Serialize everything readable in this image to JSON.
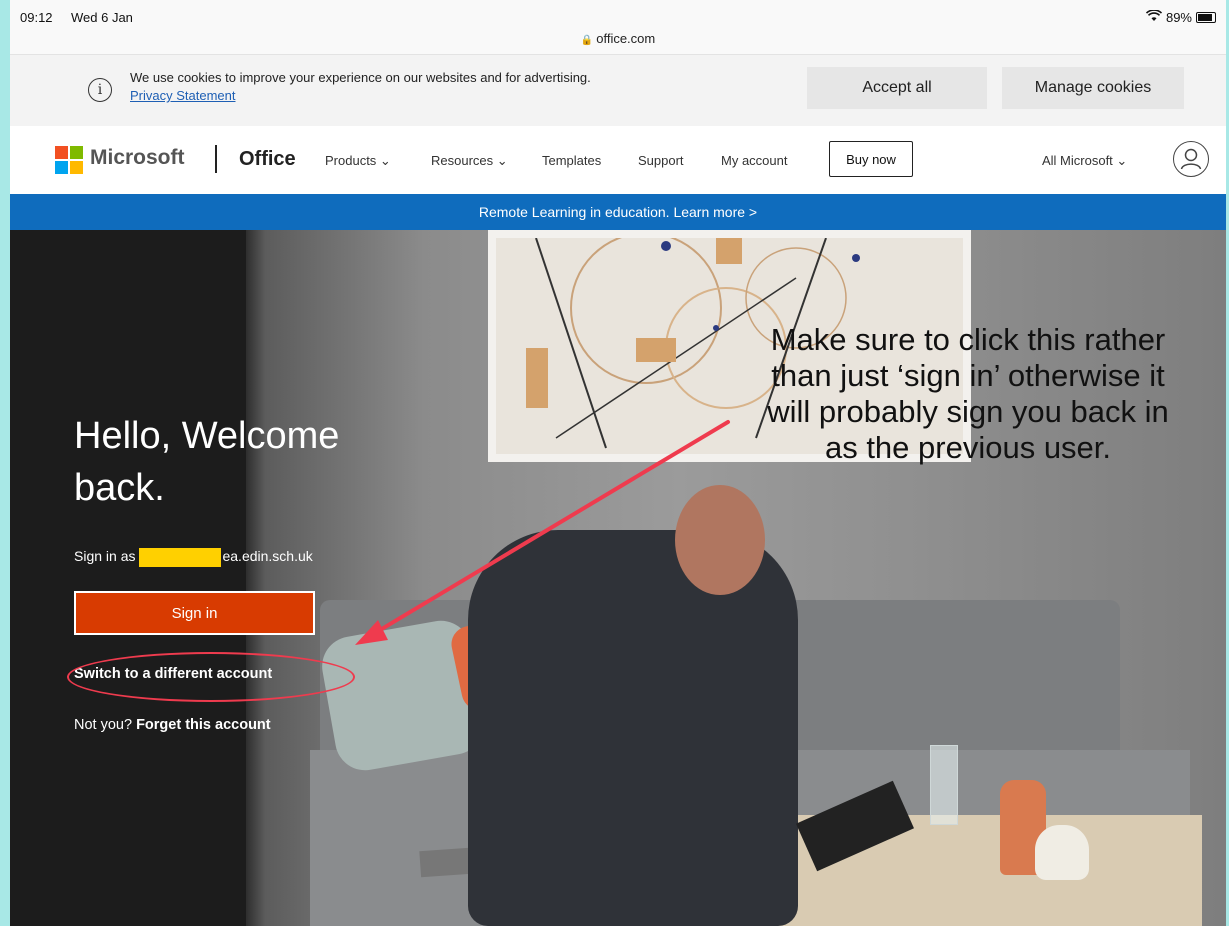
{
  "status_bar": {
    "time": "09:12",
    "date": "Wed 6 Jan",
    "url": "office.com",
    "battery": "89%"
  },
  "cookie": {
    "text": "We use cookies to improve your experience on our websites and for advertising.",
    "privacy_link": "Privacy Statement",
    "accept_label": "Accept all",
    "manage_label": "Manage cookies"
  },
  "nav": {
    "brand": "Microsoft",
    "product": "Office",
    "items": [
      "Products ⌄",
      "Resources ⌄",
      "Templates",
      "Support",
      "My account"
    ],
    "buy_now": "Buy now",
    "all_microsoft": "All Microsoft ⌄"
  },
  "banner": {
    "text": "Remote Learning in education. Learn more >"
  },
  "hero": {
    "greeting": "Hello, Welcome back.",
    "sign_in_prefix": "Sign in as",
    "sign_in_domain": "ea.edin.sch.uk",
    "sign_in_button": "Sign in",
    "switch_account": "Switch to a different account",
    "not_you": "Not you?",
    "forget_account": "Forget this account"
  },
  "annotation": {
    "text": "Make sure to click this rather than just ‘sign in’ otherwise it will probably sign you back in as the previous user.",
    "color": "#ef3b4e"
  }
}
